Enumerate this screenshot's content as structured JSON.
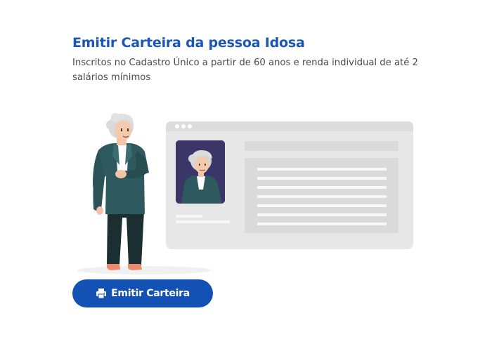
{
  "card": {
    "title": "Emitir Carteira da pessoa Idosa",
    "subtitle": "Inscritos no Cadastro Único a partir de 60 anos e renda individual de até 2 salários mínimos"
  },
  "action": {
    "button_label": "Emitir Carteira",
    "button_icon": "printer-icon"
  },
  "colors": {
    "title": "#1a56b4",
    "button_bg": "#1351b4",
    "button_text": "#ffffff",
    "subtitle": "#4a4a4a",
    "mockup_bg": "#e6e6e6",
    "jacket": "#2e5a5f"
  }
}
